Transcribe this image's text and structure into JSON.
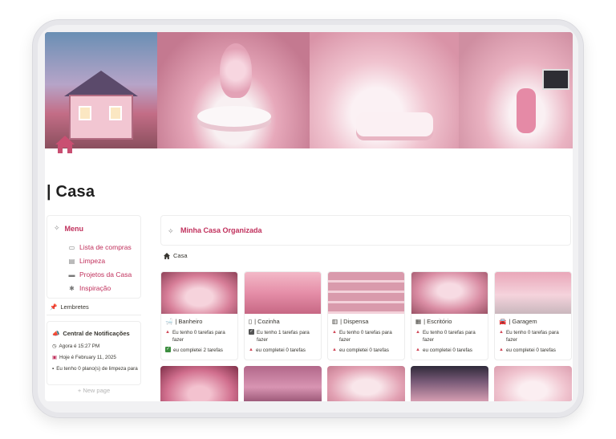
{
  "page": {
    "title": "| Casa",
    "icon": "house-icon"
  },
  "menu": {
    "title": "Menu",
    "items": [
      {
        "label": "Lista de compras",
        "icon": "basket-icon"
      },
      {
        "label": "Limpeza",
        "icon": "bucket-icon"
      },
      {
        "label": "Projetos da Casa",
        "icon": "couch-icon"
      },
      {
        "label": "Inspiração",
        "icon": "lightbulb-icon"
      }
    ]
  },
  "reminders": {
    "label": "Lembretes"
  },
  "notifications": {
    "title": "Central de Notificações",
    "lines": [
      {
        "icon": "clock-icon",
        "text": "Agora é 15:27 PM"
      },
      {
        "icon": "calendar-icon",
        "text": "Hoje é February 11, 2025"
      },
      {
        "icon": "square-icon",
        "text": "Eu tenho 0 plano(s) de limpeza para"
      }
    ]
  },
  "new_page": "+ New page",
  "callout": {
    "title": "Minha Casa Organizada"
  },
  "breadcrumb": {
    "label": "Casa"
  },
  "cards": [
    {
      "name": "| Banheiro",
      "icon": "bathtub-icon",
      "todo": "Eu tenho 0 tarefas para fazer",
      "todo_marker": "triangle",
      "done": "eu completei 2 tarefas",
      "done_marker": "check"
    },
    {
      "name": "| Cozinha",
      "icon": "fridge-icon",
      "todo": "Eu tenho 1 tarefas para fazer",
      "todo_marker": "check-dark",
      "done": "eu completei 0 tarefas",
      "done_marker": "triangle"
    },
    {
      "name": "| Dispensa",
      "icon": "shelf-icon",
      "todo": "Eu tenho 0 tarefas para fazer",
      "todo_marker": "triangle",
      "done": "eu completei 0 tarefas",
      "done_marker": "triangle"
    },
    {
      "name": "| Escritório",
      "icon": "books-icon",
      "todo": "Eu tenho 0 tarefas para fazer",
      "todo_marker": "triangle",
      "done": "eu completei 0 tarefas",
      "done_marker": "triangle"
    },
    {
      "name": "| Garagem",
      "icon": "car-icon",
      "todo": "Eu tenho 0 tarefas para fazer",
      "todo_marker": "triangle",
      "done": "eu completei 0 tarefas",
      "done_marker": "triangle"
    }
  ],
  "colors": {
    "accent": "#c0305c",
    "warning": "#d14a5a",
    "success": "#3c8e3f"
  }
}
